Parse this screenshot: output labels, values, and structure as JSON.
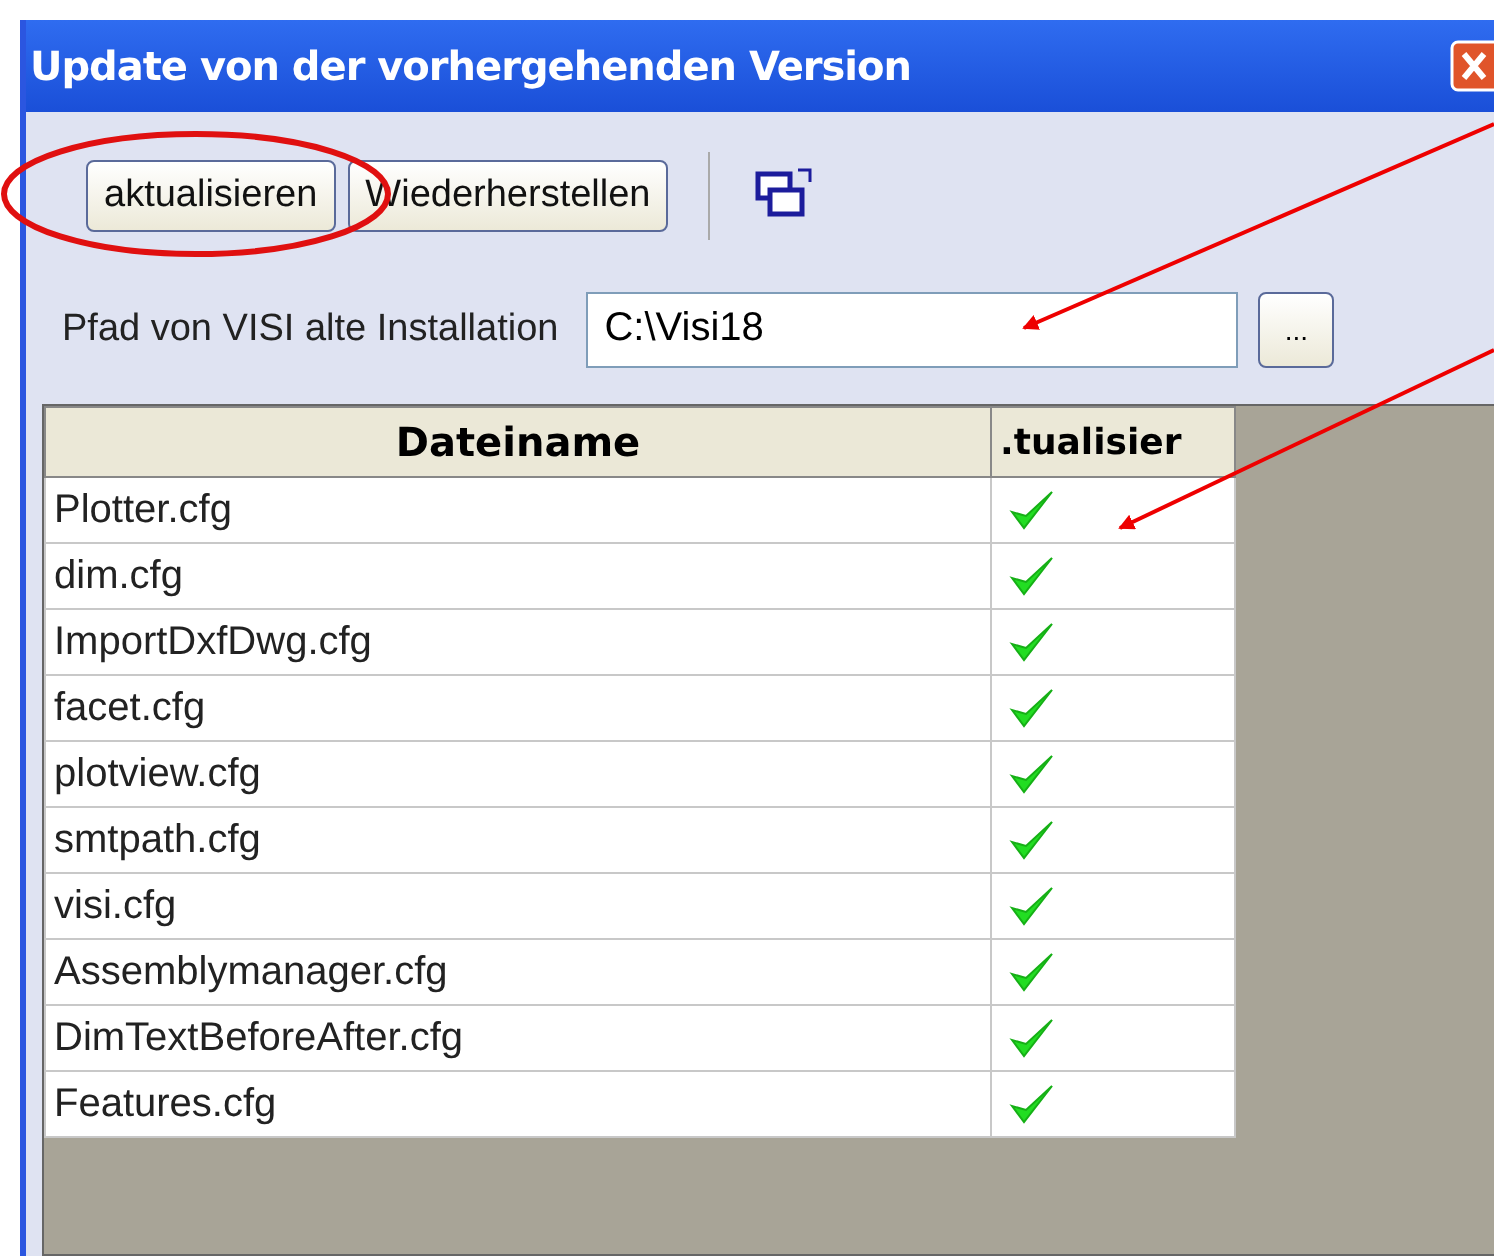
{
  "window": {
    "title": "Update von der vorhergehenden Version"
  },
  "toolbar": {
    "buttons": [
      "aktualisieren",
      "Wiederherstellen"
    ]
  },
  "path": {
    "label": "Pfad von VISI alte Installation",
    "value": "C:\\Visi18",
    "browse": "..."
  },
  "table": {
    "columns": [
      "Dateiname",
      ".tualisier"
    ],
    "rows": [
      {
        "name": "Plotter.cfg",
        "checked": true
      },
      {
        "name": "dim.cfg",
        "checked": true
      },
      {
        "name": "ImportDxfDwg.cfg",
        "checked": true
      },
      {
        "name": "facet.cfg",
        "checked": true
      },
      {
        "name": "plotview.cfg",
        "checked": true
      },
      {
        "name": "smtpath.cfg",
        "checked": true
      },
      {
        "name": "visi.cfg",
        "checked": true
      },
      {
        "name": "Assemblymanager.cfg",
        "checked": true
      },
      {
        "name": "DimTextBeforeAfter.cfg",
        "checked": true
      },
      {
        "name": "Features.cfg",
        "checked": true
      }
    ]
  }
}
